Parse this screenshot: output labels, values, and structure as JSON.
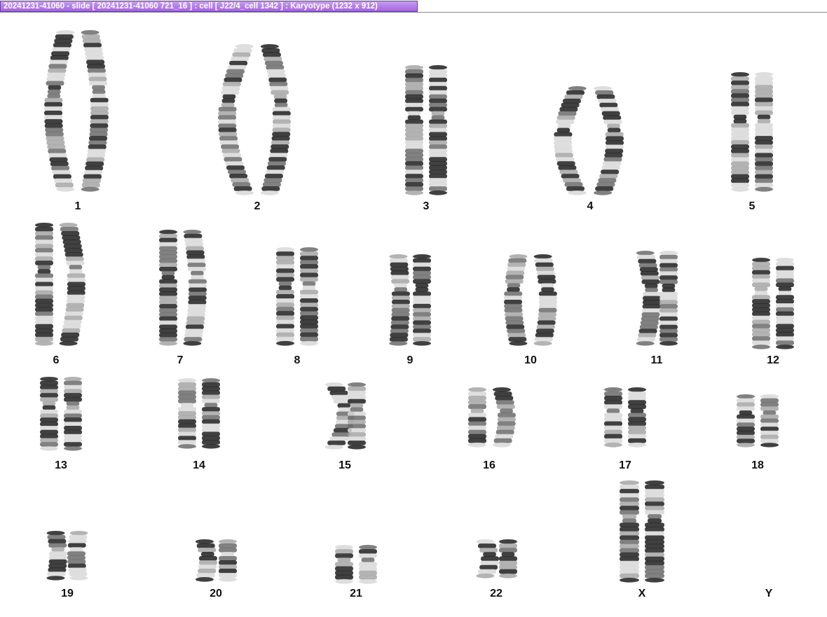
{
  "window": {
    "title": "20241231-41060 - slide [ 20241231-41060 721_16 ] : cell [ J22/4_cell 1342 ] : Karyotype  (1232 x 912)"
  },
  "karyotype": {
    "chromosomes": [
      {
        "label": "1",
        "count": 2
      },
      {
        "label": "2",
        "count": 2
      },
      {
        "label": "3",
        "count": 2
      },
      {
        "label": "4",
        "count": 2
      },
      {
        "label": "5",
        "count": 2
      },
      {
        "label": "6",
        "count": 2
      },
      {
        "label": "7",
        "count": 2
      },
      {
        "label": "8",
        "count": 2
      },
      {
        "label": "9",
        "count": 2
      },
      {
        "label": "10",
        "count": 2
      },
      {
        "label": "11",
        "count": 2
      },
      {
        "label": "12",
        "count": 2
      },
      {
        "label": "13",
        "count": 2
      },
      {
        "label": "14",
        "count": 2
      },
      {
        "label": "15",
        "count": 2
      },
      {
        "label": "16",
        "count": 2
      },
      {
        "label": "17",
        "count": 2
      },
      {
        "label": "18",
        "count": 2
      },
      {
        "label": "19",
        "count": 2
      },
      {
        "label": "20",
        "count": 2
      },
      {
        "label": "21",
        "count": 2
      },
      {
        "label": "22",
        "count": 2
      },
      {
        "label": "X",
        "count": 2
      },
      {
        "label": "Y",
        "count": 0
      }
    ]
  },
  "colors": {
    "title_tab": "#a772e6",
    "chromosome_dark": "#1e1e1e",
    "chromosome_light": "#d8d8d8",
    "background": "#ffffff"
  }
}
